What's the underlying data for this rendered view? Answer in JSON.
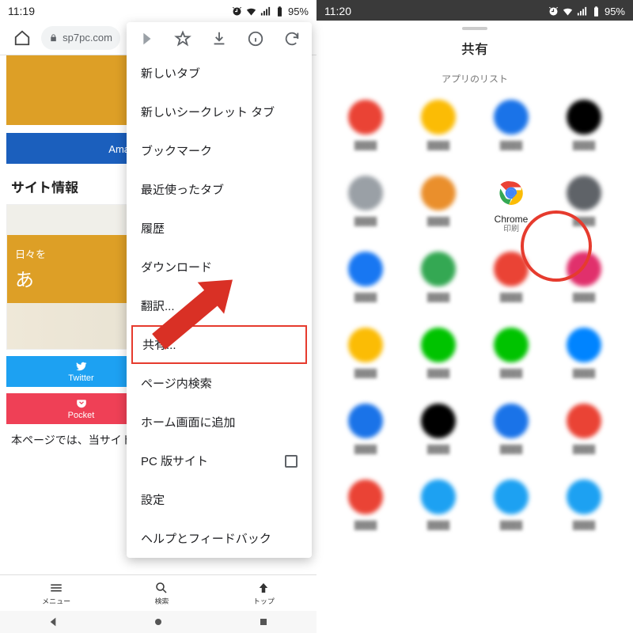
{
  "left": {
    "status": {
      "time": "11:19",
      "battery": "95%"
    },
    "url": "sp7pc.com",
    "page": {
      "bannerSmall": "日々を",
      "bannerBig": "あ",
      "amazonBtn": "Amazonタイムセール",
      "sectionTitle": "サイト情報",
      "cardSmall": "日々を",
      "cardBig": "あ",
      "bodyText": "本ページでは、当サイトの概要や管理人の紹介をします…"
    },
    "bottomNav": {
      "menu": "メニュー",
      "search": "検索",
      "top": "トップ"
    },
    "share": {
      "twitter": "Twitter",
      "pocket": "Pocket"
    },
    "menu": {
      "newTab": "新しいタブ",
      "incognito": "新しいシークレット タブ",
      "bookmarks": "ブックマーク",
      "recent": "最近使ったタブ",
      "history": "履歴",
      "downloads": "ダウンロード",
      "translate": "翻訳...",
      "share": "共有...",
      "find": "ページ内検索",
      "addHome": "ホーム画面に追加",
      "desktop": "PC 版サイト",
      "settings": "設定",
      "help": "ヘルプとフィードバック"
    }
  },
  "right": {
    "status": {
      "time": "11:20",
      "battery": "95%"
    },
    "sheet": {
      "title": "共有",
      "subtitle": "アプリのリスト",
      "chromeLabel": "Chrome",
      "chromeSub": "印刷"
    },
    "appColors": [
      "#ea4335",
      "#fbbc05",
      "#1a73e8",
      "#000",
      "#9aa0a6",
      "#ea8f2c",
      "#fff",
      "#5f6368",
      "#1877f2",
      "#34a853",
      "#ea4335",
      "#e1306c",
      "#fbbc05",
      "#00c300",
      "#00c300",
      "#0084ff",
      "#1a73e8",
      "#000",
      "#1a73e8",
      "#ea4335",
      "#ea4335",
      "#1da1f2",
      "#1da1f2",
      "#1da1f2"
    ]
  }
}
